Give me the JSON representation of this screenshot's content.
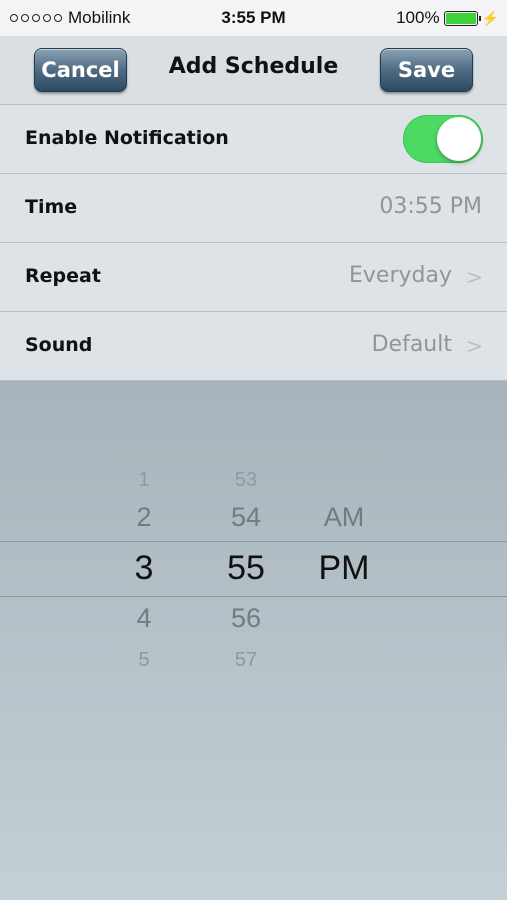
{
  "status_bar": {
    "carrier": "Mobilink",
    "time": "3:55 PM",
    "battery_text": "100%",
    "battery_level": 1.0,
    "battery_color": "#3fd33a"
  },
  "nav": {
    "cancel_label": "Cancel",
    "title": "Add Schedule",
    "save_label": "Save"
  },
  "rows": {
    "notification": {
      "label": "Enable Notification",
      "enabled": true
    },
    "time": {
      "label": "Time",
      "value": "03:55 PM"
    },
    "repeat": {
      "label": "Repeat",
      "value": "Everyday"
    },
    "sound": {
      "label": "Sound",
      "value": "Default"
    }
  },
  "picker": {
    "hours": [
      "1",
      "2",
      "3",
      "4",
      "5"
    ],
    "minutes": [
      "53",
      "54",
      "55",
      "56",
      "57"
    ],
    "period": [
      "AM",
      "PM"
    ],
    "selected": {
      "hour": "3",
      "minute": "55",
      "period": "PM"
    }
  },
  "colors": {
    "toggle_on": "#4cd964",
    "nav_button": "#4f6c84"
  }
}
